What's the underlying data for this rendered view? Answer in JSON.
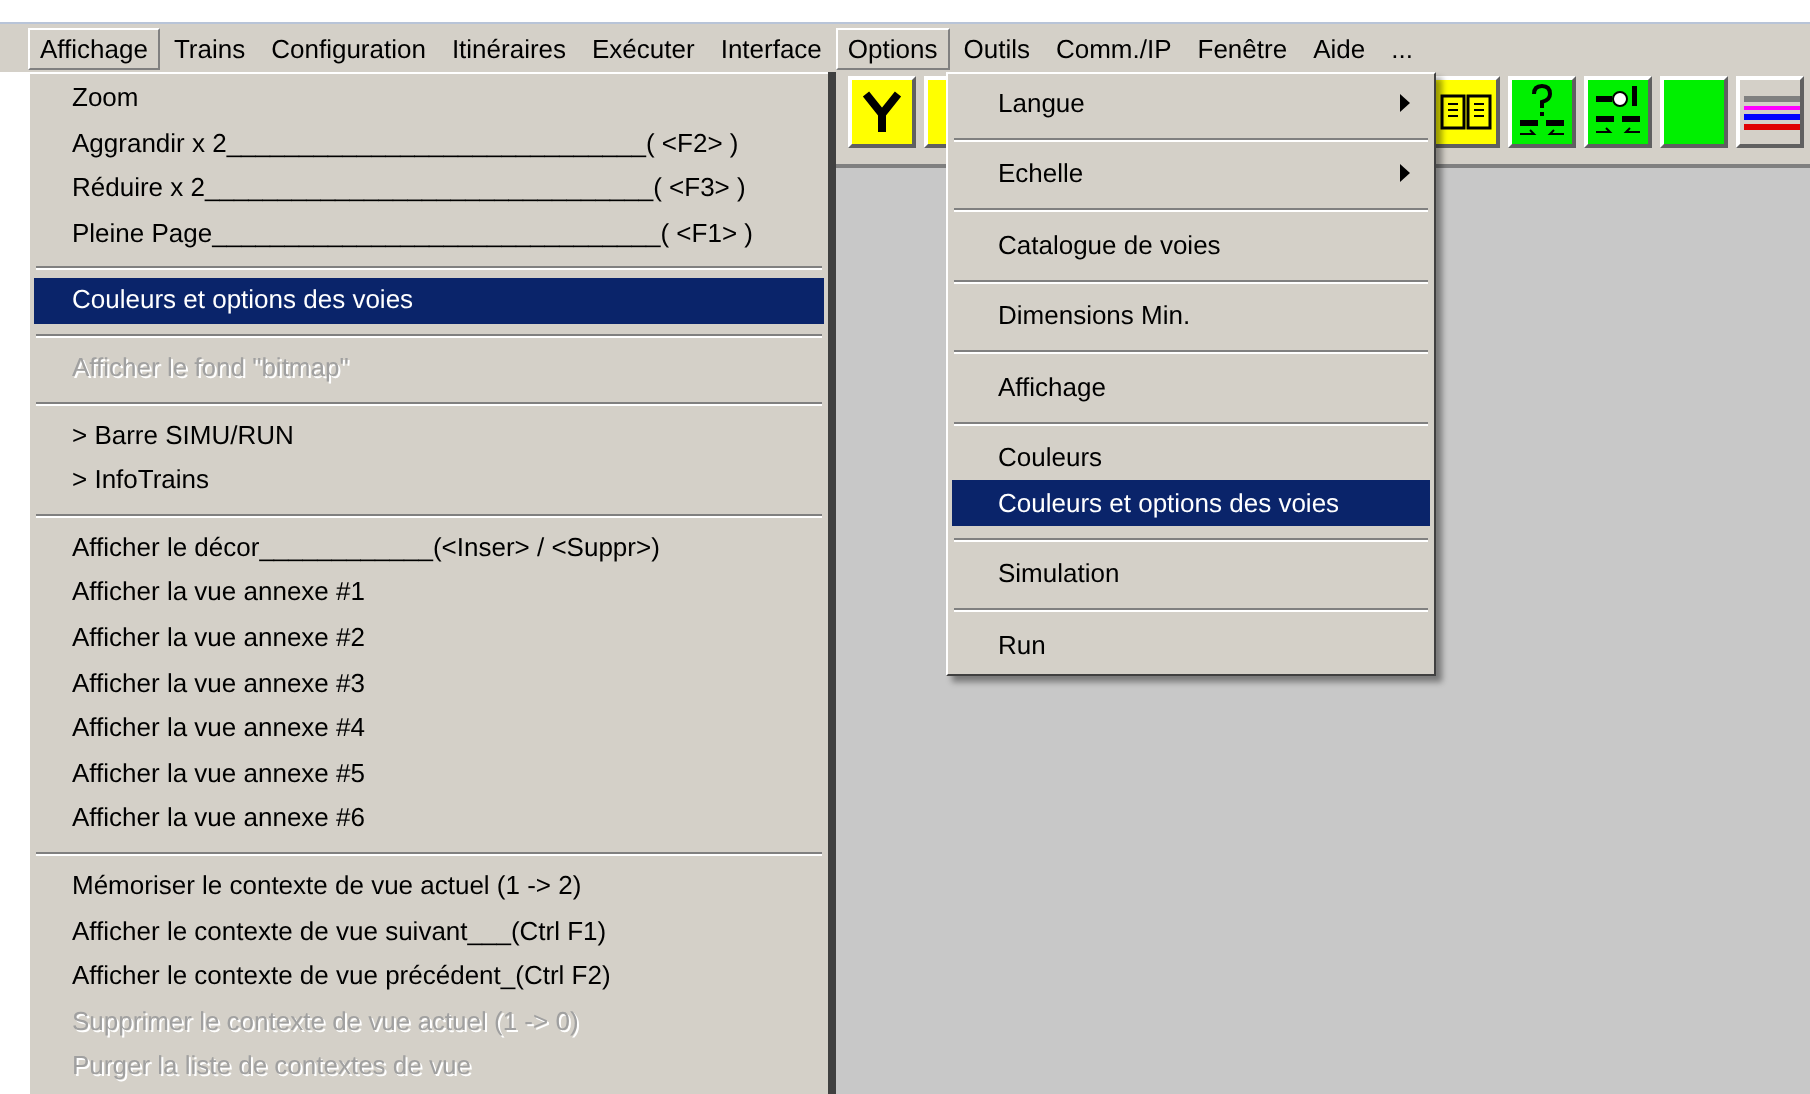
{
  "menubar": [
    {
      "label": "Affichage",
      "selected": true
    },
    {
      "label": "Trains",
      "selected": false
    },
    {
      "label": "Configuration",
      "selected": false
    },
    {
      "label": "Itinéraires",
      "selected": false
    },
    {
      "label": "Exécuter",
      "selected": false
    },
    {
      "label": "Interface",
      "selected": false
    },
    {
      "label": "Options",
      "selected": true
    },
    {
      "label": "Outils",
      "selected": false
    },
    {
      "label": "Comm./IP",
      "selected": false
    },
    {
      "label": "Fenêtre",
      "selected": false
    },
    {
      "label": "Aide",
      "selected": false
    },
    {
      "label": "...",
      "selected": false
    }
  ],
  "affichage_menu": [
    [
      {
        "label": "Zoom",
        "disabled": false,
        "selected": false
      },
      {
        "label": "Aggrandir x 2_____________________________( <F2> )",
        "disabled": false,
        "selected": false
      },
      {
        "label": "Réduire x 2_______________________________( <F3> )",
        "disabled": false,
        "selected": false
      },
      {
        "label": "Pleine Page_______________________________( <F1> )",
        "disabled": false,
        "selected": false
      }
    ],
    [
      {
        "label": "Couleurs et options des voies",
        "disabled": false,
        "selected": true
      }
    ],
    [
      {
        "label": "Afficher le fond \"bitmap\"",
        "disabled": true,
        "selected": false
      }
    ],
    [
      {
        "label": "> Barre SIMU/RUN",
        "disabled": false,
        "selected": false
      },
      {
        "label": "> InfoTrains",
        "disabled": false,
        "selected": false
      }
    ],
    [
      {
        "label": "Afficher le décor____________(<Inser> / <Suppr>)",
        "disabled": false,
        "selected": false
      },
      {
        "label": "Afficher la vue annexe #1",
        "disabled": false,
        "selected": false
      },
      {
        "label": "Afficher la vue annexe #2",
        "disabled": false,
        "selected": false
      },
      {
        "label": "Afficher la vue annexe #3",
        "disabled": false,
        "selected": false
      },
      {
        "label": "Afficher la vue annexe #4",
        "disabled": false,
        "selected": false
      },
      {
        "label": "Afficher la vue annexe #5",
        "disabled": false,
        "selected": false
      },
      {
        "label": "Afficher la vue annexe #6",
        "disabled": false,
        "selected": false
      }
    ],
    [
      {
        "label": "Mémoriser le contexte de vue actuel (1 -> 2)",
        "disabled": false,
        "selected": false
      },
      {
        "label": "Afficher le contexte de vue suivant___(Ctrl F1)",
        "disabled": false,
        "selected": false
      },
      {
        "label": "Afficher le contexte de vue précédent_(Ctrl F2)",
        "disabled": false,
        "selected": false
      },
      {
        "label": "Supprimer le contexte de vue actuel (1 -> 0)",
        "disabled": true,
        "selected": false
      },
      {
        "label": "Purger la liste de contextes de vue",
        "disabled": true,
        "selected": false
      }
    ]
  ],
  "options_menu": [
    [
      {
        "label": "Langue",
        "submenu": true,
        "selected": false
      }
    ],
    [
      {
        "label": "Echelle",
        "submenu": true,
        "selected": false
      }
    ],
    [
      {
        "label": "Catalogue de voies",
        "submenu": false,
        "selected": false
      }
    ],
    [
      {
        "label": "Dimensions Min.",
        "submenu": false,
        "selected": false
      }
    ],
    [
      {
        "label": "Affichage",
        "submenu": false,
        "selected": false
      }
    ],
    [
      {
        "label": "Couleurs",
        "submenu": false,
        "selected": false
      },
      {
        "label": "Couleurs et options des voies",
        "submenu": false,
        "selected": true
      }
    ],
    [
      {
        "label": "Simulation",
        "submenu": false,
        "selected": false
      }
    ],
    [
      {
        "label": "Run",
        "submenu": false,
        "selected": false
      }
    ]
  ]
}
